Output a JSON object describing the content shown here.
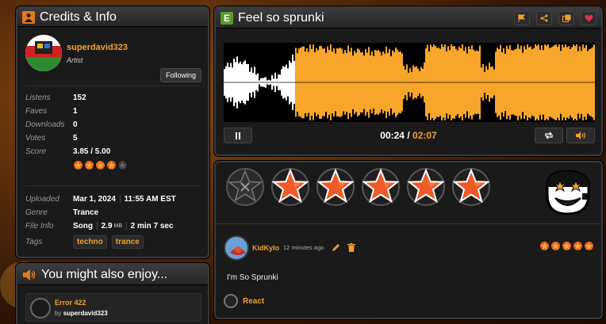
{
  "credits": {
    "title": "Credits & Info",
    "artist_name": "superdavid323",
    "artist_role": "Artist",
    "follow_label": "Following",
    "stats": [
      {
        "label": "Listens",
        "value": "152"
      },
      {
        "label": "Faves",
        "value": "1"
      },
      {
        "label": "Downloads",
        "value": "0"
      },
      {
        "label": "Votes",
        "value": "5"
      },
      {
        "label": "Score",
        "value": "3.85 / 5.00"
      }
    ],
    "score_stars": 4,
    "uploaded_label": "Uploaded",
    "uploaded_date": "Mar 1, 2024",
    "uploaded_time": "11:55 AM EST",
    "genre_label": "Genre",
    "genre_value": "Trance",
    "fileinfo_label": "File Info",
    "file_type": "Song",
    "file_size": "2.9",
    "file_size_unit": "MB",
    "file_length": "2 min 7 sec",
    "tags_label": "Tags",
    "tags": [
      "techno",
      "trance"
    ]
  },
  "enjoy": {
    "title": "You might also enjoy...",
    "item_title": "Error 422",
    "item_by": "by",
    "item_author": "superdavid323"
  },
  "player": {
    "title": "Feel so sprunki",
    "current_time": "00:24",
    "separator": "/",
    "total_time": "02:07",
    "progress_fraction": 0.19
  },
  "rating": {
    "stars_count": 5
  },
  "review": {
    "author": "KidKylo",
    "time": "12 minutes ago",
    "text": "I'm So Sprunki",
    "react_label": "React",
    "stars": 5
  },
  "colors": {
    "accent": "#f0a030",
    "panel_bg": "#1a1a1a",
    "waveform_played": "#ffffff",
    "waveform_unplayed": "#f7a52b"
  }
}
